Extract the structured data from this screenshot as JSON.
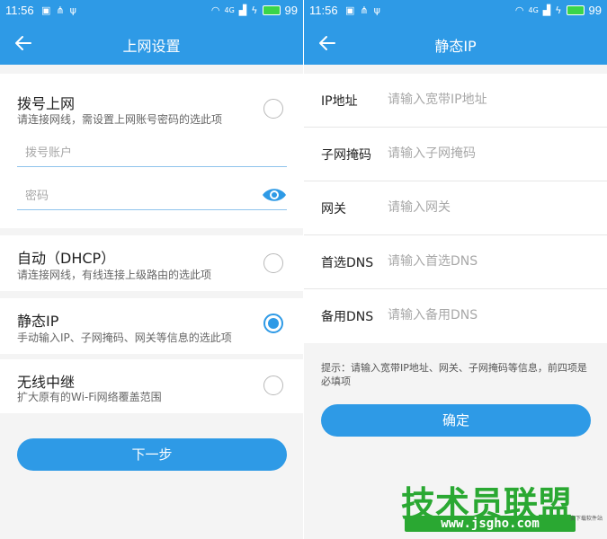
{
  "statusbar": {
    "time": "11:56",
    "battery": "99",
    "network": "4G"
  },
  "left": {
    "title": "上网设置",
    "options": [
      {
        "title": "拨号上网",
        "subtitle": "请连接网线，需设置上网账号密码的选此项",
        "selected": false
      },
      {
        "title": "自动（DHCP）",
        "subtitle": "请连接网线，有线连接上级路由的选此项",
        "selected": false
      },
      {
        "title": "静态IP",
        "subtitle": "手动输入IP、子网掩码、网关等信息的选此项",
        "selected": true
      },
      {
        "title": "无线中继",
        "subtitle": "扩大原有的Wi-Fi网络覆盖范围",
        "selected": false
      }
    ],
    "account_placeholder": "拨号账户",
    "password_placeholder": "密码",
    "next_button": "下一步"
  },
  "right": {
    "title": "静态IP",
    "fields": [
      {
        "label": "IP地址",
        "placeholder": "请输入宽带IP地址"
      },
      {
        "label": "子网掩码",
        "placeholder": "请输入子网掩码"
      },
      {
        "label": "网关",
        "placeholder": "请输入网关"
      },
      {
        "label": "首选DNS",
        "placeholder": "请输入首选DNS"
      },
      {
        "label": "备用DNS",
        "placeholder": "请输入备用DNS"
      }
    ],
    "tip": "提示：请输入宽带IP地址、网关、子网掩码等信息，前四项是必填项",
    "confirm_button": "确定"
  },
  "watermark": {
    "main": "技术员联盟",
    "url": "www.jsgho.com",
    "small": "安下载软件站"
  },
  "colors": {
    "accent": "#2e9ae6",
    "background": "#f4f4f4",
    "watermark": "#2aa832"
  }
}
